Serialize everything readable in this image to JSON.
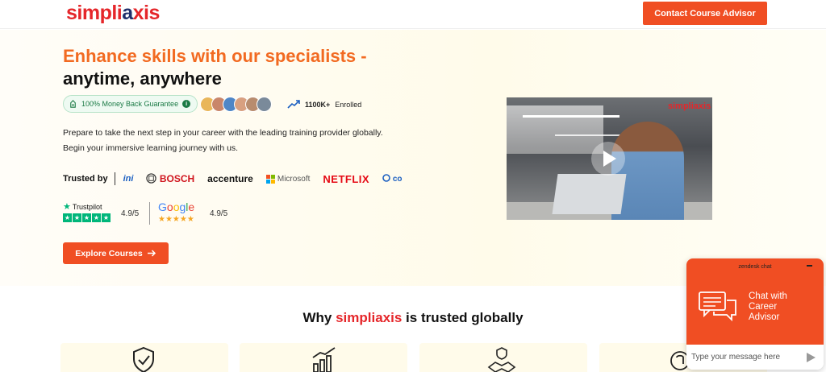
{
  "header": {
    "logo_text_a": "simpli",
    "logo_text_b": "a",
    "logo_text_c": "xis",
    "contact_label": "Contact Course Advisor"
  },
  "hero": {
    "title_line1": "Enhance skills with our specialists -",
    "title_line2": "anytime, anywhere",
    "money_back": "100% Money Back Guarantee",
    "enrolled_count": "1100K+",
    "enrolled_label": "Enrolled",
    "description_line1": "Prepare to take the next step in your career with the leading training provider globally.",
    "description_line2": "Begin your immersive learning journey with us.",
    "trusted_label": "Trusted by",
    "brands": [
      "ini",
      "BOSCH",
      "accenture",
      "Microsoft",
      "NETFLIX",
      "co"
    ],
    "trustpilot_name": "Trustpilot",
    "trustpilot_score": "4.9/5",
    "google_name": "Google",
    "google_score": "4.9/5",
    "explore_label": "Explore Courses"
  },
  "video": {
    "logo": "simpliaxis"
  },
  "why": {
    "prefix": "Why",
    "brand": "simpliaxis",
    "suffix": "is trusted globally"
  },
  "chat": {
    "provider": "zendesk chat",
    "title_line1": "Chat with",
    "title_line2": "Career",
    "title_line3": "Advisor",
    "input_placeholder": "Type your message here"
  },
  "colors": {
    "accent": "#f04e23",
    "brand_red": "#e5262a",
    "title_orange": "#f26a21"
  }
}
